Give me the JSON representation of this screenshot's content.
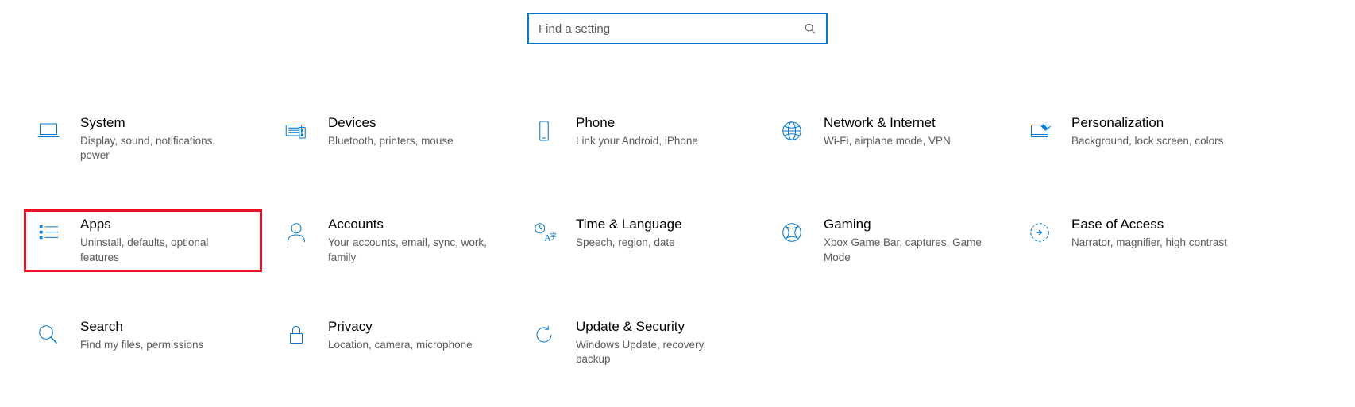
{
  "search": {
    "placeholder": "Find a setting"
  },
  "tiles": [
    {
      "key": "system",
      "title": "System",
      "desc": "Display, sound, notifications, power"
    },
    {
      "key": "devices",
      "title": "Devices",
      "desc": "Bluetooth, printers, mouse"
    },
    {
      "key": "phone",
      "title": "Phone",
      "desc": "Link your Android, iPhone"
    },
    {
      "key": "network",
      "title": "Network & Internet",
      "desc": "Wi-Fi, airplane mode, VPN"
    },
    {
      "key": "personalization",
      "title": "Personalization",
      "desc": "Background, lock screen, colors"
    },
    {
      "key": "apps",
      "title": "Apps",
      "desc": "Uninstall, defaults, optional features"
    },
    {
      "key": "accounts",
      "title": "Accounts",
      "desc": "Your accounts, email, sync, work, family"
    },
    {
      "key": "time",
      "title": "Time & Language",
      "desc": "Speech, region, date"
    },
    {
      "key": "gaming",
      "title": "Gaming",
      "desc": "Xbox Game Bar, captures, Game Mode"
    },
    {
      "key": "ease",
      "title": "Ease of Access",
      "desc": "Narrator, magnifier, high contrast"
    },
    {
      "key": "search",
      "title": "Search",
      "desc": "Find my files, permissions"
    },
    {
      "key": "privacy",
      "title": "Privacy",
      "desc": "Location, camera, microphone"
    },
    {
      "key": "update",
      "title": "Update & Security",
      "desc": "Windows Update, recovery, backup"
    }
  ],
  "highlighted_key": "apps"
}
